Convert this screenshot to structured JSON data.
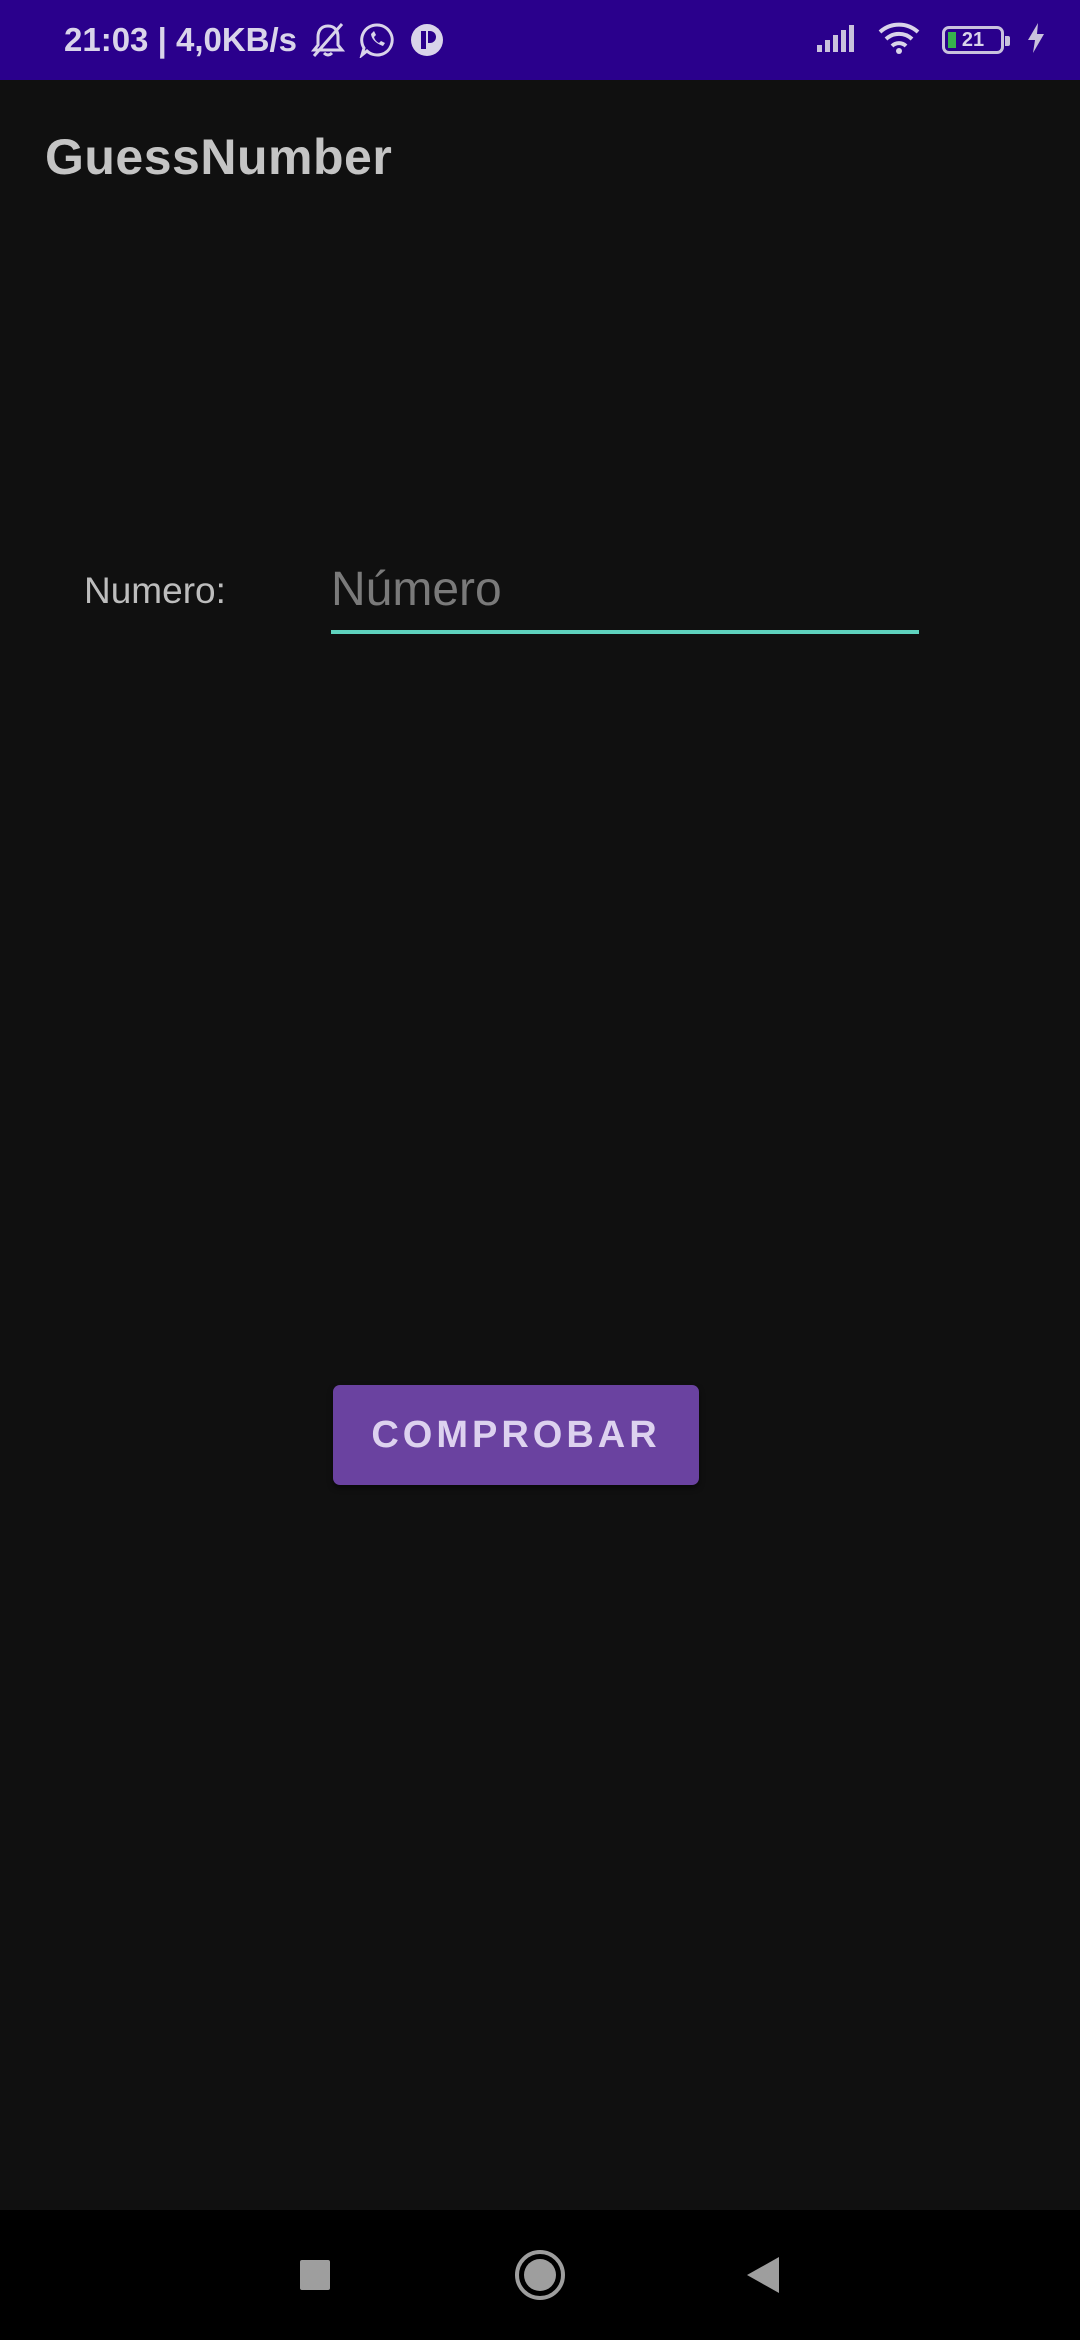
{
  "status_bar": {
    "time_and_speed": "21:03 | 4,0KB/s",
    "battery_level": "21",
    "icons": [
      "bell-muted-icon",
      "whatsapp-icon",
      "vpn-icon",
      "signal-icon",
      "wifi-icon",
      "battery-icon",
      "charging-icon"
    ]
  },
  "app": {
    "title": "GuessNumber"
  },
  "form": {
    "number_label": "Numero:",
    "number_placeholder": "Número",
    "number_value": "",
    "check_button_label": "COMPROBAR"
  },
  "nav_bar": {
    "icons": [
      "recents-square-icon",
      "home-circle-icon",
      "back-triangle-icon"
    ]
  },
  "colors": {
    "status_bar_bg": "#2a008c",
    "background": "#101010",
    "accent_underline": "#5fd3be",
    "button_bg": "#6a42a0"
  }
}
